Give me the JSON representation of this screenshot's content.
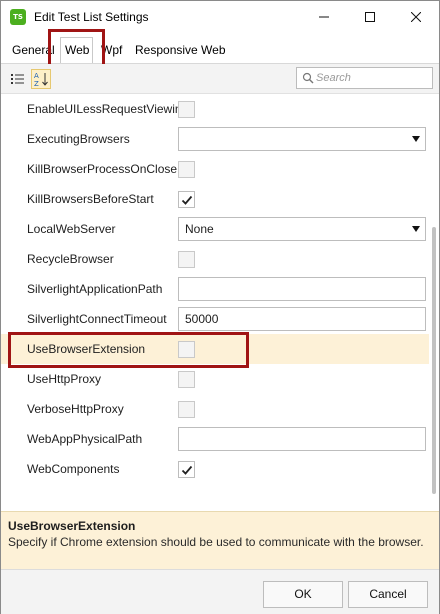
{
  "window": {
    "title": "Edit Test List Settings",
    "icon_text": "TS",
    "icon_name": "test-studio-app-icon"
  },
  "tabs": [
    {
      "label": "General"
    },
    {
      "label": "Web",
      "active": true
    },
    {
      "label": "Wpf"
    },
    {
      "label": "Responsive Web"
    }
  ],
  "search": {
    "placeholder": "Search"
  },
  "properties": [
    {
      "name": "EnableUILessRequestViewing",
      "type": "checkbox",
      "checked": false
    },
    {
      "name": "ExecutingBrowsers",
      "type": "combo",
      "value": ""
    },
    {
      "name": "KillBrowserProcessOnClose",
      "type": "checkbox",
      "checked": false
    },
    {
      "name": "KillBrowsersBeforeStart",
      "type": "checkbox",
      "checked": true
    },
    {
      "name": "LocalWebServer",
      "type": "combo",
      "value": "None"
    },
    {
      "name": "RecycleBrowser",
      "type": "checkbox",
      "checked": false
    },
    {
      "name": "SilverlightApplicationPath",
      "type": "text",
      "value": ""
    },
    {
      "name": "SilverlightConnectTimeout",
      "type": "text",
      "value": "50000"
    },
    {
      "name": "UseBrowserExtension",
      "type": "checkbox",
      "checked": false,
      "selected": true
    },
    {
      "name": "UseHttpProxy",
      "type": "checkbox",
      "checked": false
    },
    {
      "name": "VerboseHttpProxy",
      "type": "checkbox",
      "checked": false
    },
    {
      "name": "WebAppPhysicalPath",
      "type": "text",
      "value": ""
    },
    {
      "name": "WebComponents",
      "type": "checkbox",
      "checked": true
    }
  ],
  "description": {
    "title": "UseBrowserExtension",
    "text": "Specify if Chrome extension should be used to communicate with the browser."
  },
  "buttons": {
    "ok": "OK",
    "cancel": "Cancel"
  },
  "colors": {
    "highlight_border": "#a01414",
    "selected_row": "#fdf1d7",
    "app_icon": "#4caf1f"
  }
}
